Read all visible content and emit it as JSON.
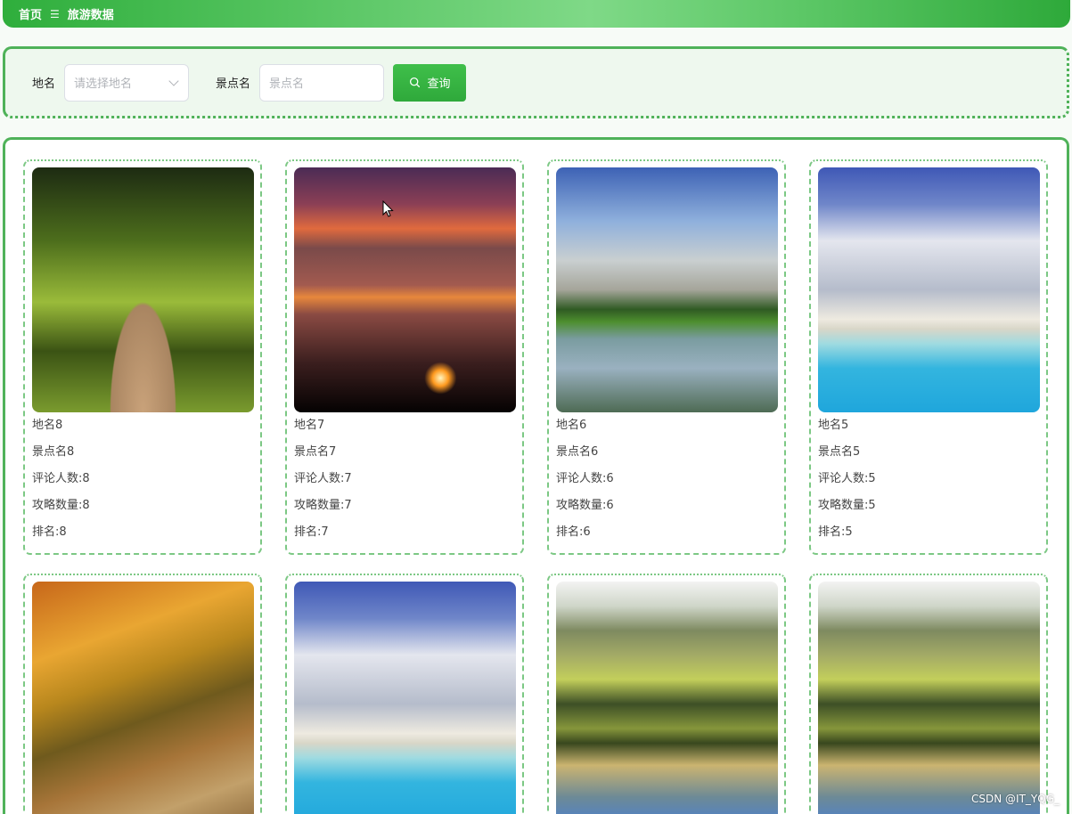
{
  "breadcrumb": {
    "home": "首页",
    "separator": "☰",
    "current": "旅游数据"
  },
  "search": {
    "place_label": "地名",
    "place_placeholder": "请选择地名",
    "spot_label": "景点名",
    "spot_placeholder": "景点名",
    "query_button": "查询"
  },
  "cards": [
    {
      "place": "地名8",
      "spot": "景点名8",
      "reviews": "评论人数:8",
      "guides": "攻略数量:8",
      "rank": "排名:8",
      "image": "forest-path"
    },
    {
      "place": "地名7",
      "spot": "景点名7",
      "reviews": "评论人数:7",
      "guides": "攻略数量:7",
      "rank": "排名:7",
      "image": "sunset"
    },
    {
      "place": "地名6",
      "spot": "景点名6",
      "reviews": "评论人数:6",
      "guides": "攻略数量:6",
      "rank": "排名:6",
      "image": "mountain-lake"
    },
    {
      "place": "地名5",
      "spot": "景点名5",
      "reviews": "评论人数:5",
      "guides": "攻略数量:5",
      "rank": "排名:5",
      "image": "tropical-beach"
    },
    {
      "image": "autumn-path"
    },
    {
      "image": "tropical-beach"
    },
    {
      "image": "mountain-reflection"
    },
    {
      "image": "mountain-reflection"
    }
  ],
  "watermark": "CSDN @IT_YQG_",
  "colors": {
    "accent": "#2fae3c",
    "panel_bg": "#eef8ee",
    "border": "#4fb259"
  }
}
